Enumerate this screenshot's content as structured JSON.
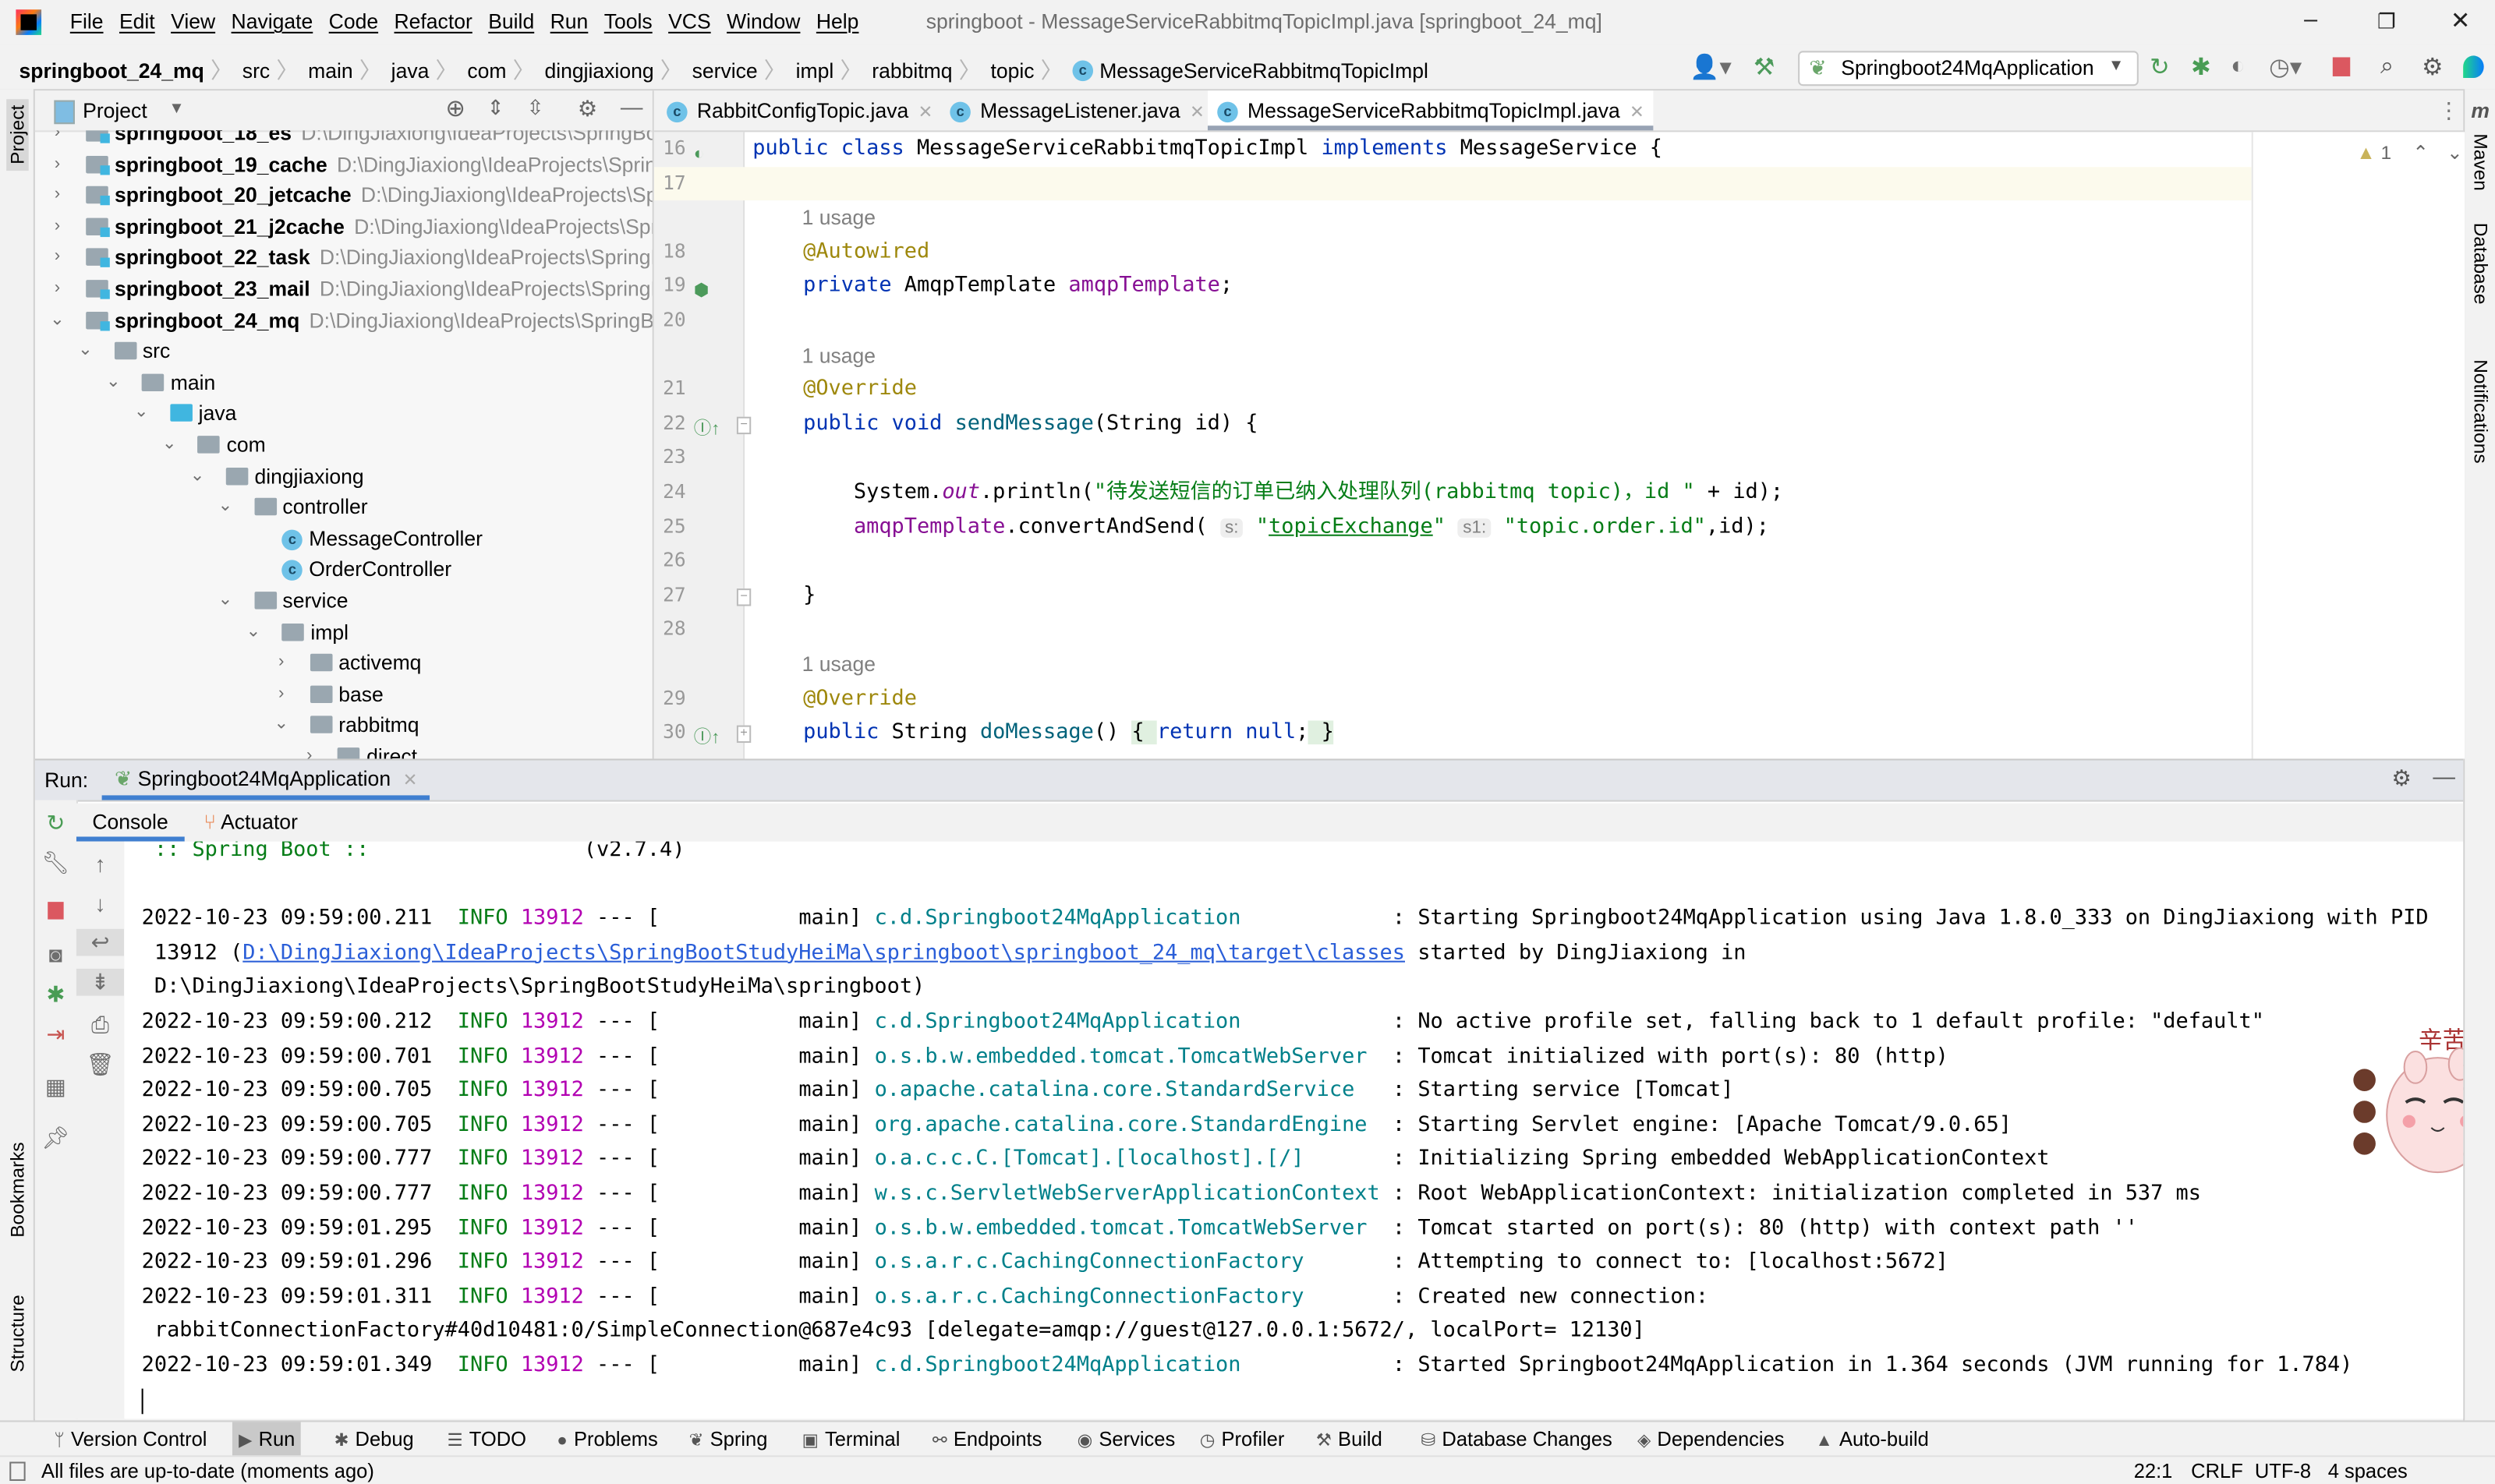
{
  "app": {
    "menu": [
      "File",
      "Edit",
      "View",
      "Navigate",
      "Code",
      "Refactor",
      "Build",
      "Run",
      "Tools",
      "VCS",
      "Window",
      "Help"
    ],
    "window_title": "springboot - MessageServiceRabbitmqTopicImpl.java [springboot_24_mq]",
    "window_controls": {
      "minimize": "–",
      "restore": "❐",
      "close": "✕"
    }
  },
  "navbar": {
    "breadcrumbs": [
      "springboot_24_mq",
      "src",
      "main",
      "java",
      "com",
      "dingjiaxiong",
      "service",
      "impl",
      "rabbitmq",
      "topic",
      "MessageServiceRabbitmqTopicImpl"
    ],
    "run_config": "Springboot24MqApplication",
    "icons": [
      "account-icon",
      "build-hammer-icon",
      "run-config-icon",
      "rerun-icon",
      "debug-icon",
      "coverage-icon",
      "profile-icon",
      "stop-icon",
      "search-icon",
      "settings-icon",
      "toolbox-icon"
    ]
  },
  "left_stripe": {
    "project": "Project",
    "bookmarks": "Bookmarks",
    "structure": "Structure"
  },
  "right_stripe": {
    "maven": "Maven",
    "database": "Database",
    "notifications": "Notifications"
  },
  "project": {
    "title": "Project",
    "tree": [
      {
        "label": "springboot_18_es",
        "path": "D:\\DingJiaxiong\\IdeaProjects\\SpringBootS",
        "depth": 0,
        "kind": "module",
        "state": "collapsed"
      },
      {
        "label": "springboot_19_cache",
        "path": "D:\\DingJiaxiong\\IdeaProjects\\SpringBo",
        "depth": 0,
        "kind": "module",
        "state": "collapsed"
      },
      {
        "label": "springboot_20_jetcache",
        "path": "D:\\DingJiaxiong\\IdeaProjects\\Spring",
        "depth": 0,
        "kind": "module",
        "state": "collapsed"
      },
      {
        "label": "springboot_21_j2cache",
        "path": "D:\\DingJiaxiong\\IdeaProjects\\Spring",
        "depth": 0,
        "kind": "module",
        "state": "collapsed"
      },
      {
        "label": "springboot_22_task",
        "path": "D:\\DingJiaxiong\\IdeaProjects\\SpringBoo",
        "depth": 0,
        "kind": "module",
        "state": "collapsed"
      },
      {
        "label": "springboot_23_mail",
        "path": "D:\\DingJiaxiong\\IdeaProjects\\SpringBoo",
        "depth": 0,
        "kind": "module",
        "state": "collapsed"
      },
      {
        "label": "springboot_24_mq",
        "path": "D:\\DingJiaxiong\\IdeaProjects\\SpringBoot",
        "depth": 0,
        "kind": "module",
        "state": "expanded"
      },
      {
        "label": "src",
        "depth": 1,
        "kind": "folder",
        "state": "expanded"
      },
      {
        "label": "main",
        "depth": 2,
        "kind": "folder",
        "state": "expanded"
      },
      {
        "label": "java",
        "depth": 3,
        "kind": "source",
        "state": "expanded"
      },
      {
        "label": "com",
        "depth": 4,
        "kind": "package",
        "state": "expanded"
      },
      {
        "label": "dingjiaxiong",
        "depth": 5,
        "kind": "package",
        "state": "expanded"
      },
      {
        "label": "controller",
        "depth": 6,
        "kind": "package",
        "state": "expanded"
      },
      {
        "label": "MessageController",
        "depth": 7,
        "kind": "class",
        "state": "leaf"
      },
      {
        "label": "OrderController",
        "depth": 7,
        "kind": "class",
        "state": "leaf"
      },
      {
        "label": "service",
        "depth": 6,
        "kind": "package",
        "state": "expanded"
      },
      {
        "label": "impl",
        "depth": 7,
        "kind": "package",
        "state": "expanded"
      },
      {
        "label": "activemq",
        "depth": 8,
        "kind": "package",
        "state": "collapsed"
      },
      {
        "label": "base",
        "depth": 8,
        "kind": "package",
        "state": "collapsed"
      },
      {
        "label": "rabbitmq",
        "depth": 8,
        "kind": "package",
        "state": "expanded"
      },
      {
        "label": "direct",
        "depth": 9,
        "kind": "package",
        "state": "collapsed"
      }
    ]
  },
  "editor": {
    "tabs": [
      {
        "label": "RabbitConfigTopic.java",
        "active": false
      },
      {
        "label": "MessageListener.java",
        "active": false
      },
      {
        "label": "MessageServiceRabbitmqTopicImpl.java",
        "active": true
      }
    ],
    "inspection": {
      "warnings": "1"
    },
    "rows": [
      {
        "num": "16",
        "gutter": "implements-icon",
        "tokens": [
          [
            "kw",
            "public class "
          ],
          [
            "",
            "MessageServiceRabbitmqTopicImpl "
          ],
          [
            "kw",
            "implements "
          ],
          [
            "",
            "MessageService {"
          ]
        ]
      },
      {
        "num": "17",
        "caret": true,
        "tokens": []
      },
      {
        "inlay": "1 usage"
      },
      {
        "num": "18",
        "tokens": [
          [
            "",
            "    "
          ],
          [
            "ann",
            "@Autowired"
          ]
        ]
      },
      {
        "num": "19",
        "gutter": "bean-icon",
        "tokens": [
          [
            "",
            "    "
          ],
          [
            "kw",
            "private "
          ],
          [
            "",
            "AmqpTemplate "
          ],
          [
            "fld",
            "amqpTemplate"
          ],
          [
            "",
            ";"
          ]
        ]
      },
      {
        "num": "20",
        "tokens": []
      },
      {
        "inlay": "1 usage"
      },
      {
        "num": "21",
        "tokens": [
          [
            "",
            "    "
          ],
          [
            "ann",
            "@Override"
          ]
        ]
      },
      {
        "num": "22",
        "gutter": "override-icon",
        "fold": "−",
        "tokens": [
          [
            "",
            "    "
          ],
          [
            "kw",
            "public void "
          ],
          [
            "fn",
            "sendMessage"
          ],
          [
            "",
            "(String id) {"
          ]
        ]
      },
      {
        "num": "23",
        "tokens": []
      },
      {
        "num": "24",
        "tokens": [
          [
            "",
            "        System."
          ],
          [
            "st",
            "out"
          ],
          [
            "",
            ".println("
          ],
          [
            "str",
            "\"待发送短信的订单已纳入处理队列(rabbitmq topic)，id \""
          ],
          [
            "",
            " + id);"
          ]
        ]
      },
      {
        "num": "25",
        "tokens": [
          [
            "",
            "        "
          ],
          [
            "fld",
            "amqpTemplate"
          ],
          [
            "",
            ".convertAndSend( "
          ],
          [
            "hint",
            "s:"
          ],
          [
            "",
            " "
          ],
          [
            "str",
            "\""
          ],
          [
            "strul",
            "topicExchange"
          ],
          [
            "str",
            "\""
          ],
          [
            ", ",
            " "
          ],
          [
            "hint",
            "s1:"
          ],
          [
            "",
            " "
          ],
          [
            "str",
            "\"topic.order.id\""
          ],
          [
            "",
            ",id);"
          ]
        ]
      },
      {
        "num": "26",
        "tokens": []
      },
      {
        "num": "27",
        "fold": "−",
        "tokens": [
          [
            "",
            "    }"
          ]
        ]
      },
      {
        "num": "28",
        "tokens": []
      },
      {
        "inlay": "1 usage"
      },
      {
        "num": "29",
        "tokens": [
          [
            "",
            "    "
          ],
          [
            "ann",
            "@Override"
          ]
        ]
      },
      {
        "num": "30",
        "gutter": "override-icon",
        "fold": "+",
        "tokens": [
          [
            "",
            "    "
          ],
          [
            "kw",
            "public "
          ],
          [
            "",
            "String "
          ],
          [
            "fn",
            "doMessage"
          ],
          [
            "",
            "() "
          ],
          [
            "brace",
            "{ "
          ],
          [
            "kw",
            "return null"
          ],
          [
            "",
            ";"
          ],
          [
            "brace",
            " }"
          ]
        ]
      }
    ]
  },
  "run": {
    "label": "Run:",
    "tab": "Springboot24MqApplication",
    "subtabs": [
      "Console",
      "Actuator"
    ],
    "banner": {
      "text": ":: Spring Boot ::",
      "version": "(v2.7.4)"
    },
    "logs": [
      {
        "date": "2022-10-23 09:59:00.211",
        "level": "INFO",
        "pid": "13912",
        "thread": "main",
        "logger": "c.d.Springboot24MqApplication",
        "message": "Starting Springboot24MqApplication using Java 1.8.0_333 on DingJiaxiong with PID",
        "cont": [
          {
            "pre": "13912 (",
            "link": "D:\\DingJiaxiong\\IdeaProjects\\SpringBootStudyHeiMa\\springboot\\springboot_24_mq\\target\\classes",
            "post": " started by DingJiaxiong in"
          },
          {
            "pre": "D:\\DingJiaxiong\\IdeaProjects\\SpringBootStudyHeiMa\\springboot)"
          }
        ]
      },
      {
        "date": "2022-10-23 09:59:00.212",
        "level": "INFO",
        "pid": "13912",
        "thread": "main",
        "logger": "c.d.Springboot24MqApplication",
        "message": "No active profile set, falling back to 1 default profile: \"default\""
      },
      {
        "date": "2022-10-23 09:59:00.701",
        "level": "INFO",
        "pid": "13912",
        "thread": "main",
        "logger": "o.s.b.w.embedded.tomcat.TomcatWebServer",
        "message": "Tomcat initialized with port(s): 80 (http)"
      },
      {
        "date": "2022-10-23 09:59:00.705",
        "level": "INFO",
        "pid": "13912",
        "thread": "main",
        "logger": "o.apache.catalina.core.StandardService",
        "message": "Starting service [Tomcat]"
      },
      {
        "date": "2022-10-23 09:59:00.705",
        "level": "INFO",
        "pid": "13912",
        "thread": "main",
        "logger": "org.apache.catalina.core.StandardEngine",
        "message": "Starting Servlet engine: [Apache Tomcat/9.0.65]"
      },
      {
        "date": "2022-10-23 09:59:00.777",
        "level": "INFO",
        "pid": "13912",
        "thread": "main",
        "logger": "o.a.c.c.C.[Tomcat].[localhost].[/]",
        "message": "Initializing Spring embedded WebApplicationContext"
      },
      {
        "date": "2022-10-23 09:59:00.777",
        "level": "INFO",
        "pid": "13912",
        "thread": "main",
        "logger": "w.s.c.ServletWebServerApplicationContext",
        "message": "Root WebApplicationContext: initialization completed in 537 ms"
      },
      {
        "date": "2022-10-23 09:59:01.295",
        "level": "INFO",
        "pid": "13912",
        "thread": "main",
        "logger": "o.s.b.w.embedded.tomcat.TomcatWebServer",
        "message": "Tomcat started on port(s): 80 (http) with context path ''"
      },
      {
        "date": "2022-10-23 09:59:01.296",
        "level": "INFO",
        "pid": "13912",
        "thread": "main",
        "logger": "o.s.a.r.c.CachingConnectionFactory",
        "message": "Attempting to connect to: [localhost:5672]"
      },
      {
        "date": "2022-10-23 09:59:01.311",
        "level": "INFO",
        "pid": "13912",
        "thread": "main",
        "logger": "o.s.a.r.c.CachingConnectionFactory",
        "message": "Created new connection:",
        "cont": [
          {
            "pre": "rabbitConnectionFactory#40d10481:0/SimpleConnection@687e4c93 [delegate=amqp://guest@127.0.0.1:5672/, localPort= 12130]"
          }
        ]
      },
      {
        "date": "2022-10-23 09:59:01.349",
        "level": "INFO",
        "pid": "13912",
        "thread": "main",
        "logger": "c.d.Springboot24MqApplication",
        "message": "Started Springboot24MqApplication in 1.364 seconds (JVM running for 1.784)"
      }
    ],
    "sticker": {
      "text": "辛苦啦"
    }
  },
  "tool_windows": [
    {
      "label": "Version Control",
      "icon": "version-control-icon",
      "glyph": "ᛘ"
    },
    {
      "label": "Run",
      "icon": "run-icon",
      "glyph": "▶",
      "active": true
    },
    {
      "label": "Debug",
      "icon": "debug-icon",
      "glyph": "✱"
    },
    {
      "label": "TODO",
      "icon": "todo-icon",
      "glyph": "☰"
    },
    {
      "label": "Problems",
      "icon": "problems-icon",
      "glyph": "●"
    },
    {
      "label": "Spring",
      "icon": "spring-icon",
      "glyph": "❦"
    },
    {
      "label": "Terminal",
      "icon": "terminal-icon",
      "glyph": "▣"
    },
    {
      "label": "Endpoints",
      "icon": "endpoints-icon",
      "glyph": "⚯"
    },
    {
      "label": "Services",
      "icon": "services-icon",
      "glyph": "◉"
    },
    {
      "label": "Profiler",
      "icon": "profiler-icon",
      "glyph": "◷"
    },
    {
      "label": "Build",
      "icon": "build-icon",
      "glyph": "⚒"
    },
    {
      "label": "Database Changes",
      "icon": "database-changes-icon",
      "glyph": "⛁"
    },
    {
      "label": "Dependencies",
      "icon": "dependencies-icon",
      "glyph": "◈"
    },
    {
      "label": "Auto-build",
      "icon": "auto-build-icon",
      "glyph": "▲"
    }
  ],
  "status": {
    "message": "All files are up-to-date (moments ago)",
    "position": "22:1",
    "line_sep": "CRLF",
    "encoding": "UTF-8",
    "indent": "4 spaces"
  }
}
